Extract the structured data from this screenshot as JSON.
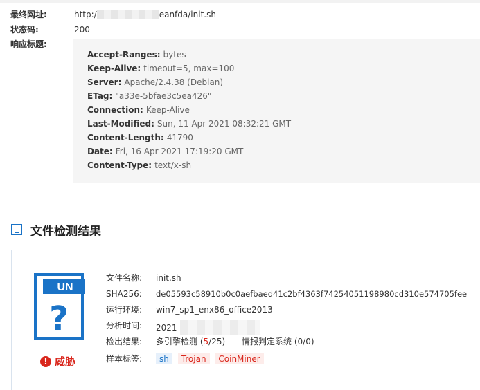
{
  "response": {
    "final_url_label": "最终网址:",
    "final_url_prefix": "http:/",
    "final_url_suffix": "eanfda/init.sh",
    "status_label": "状态码:",
    "status_value": "200",
    "headers_label": "响应标题:",
    "headers": [
      {
        "key": "Accept-Ranges:",
        "value": "bytes"
      },
      {
        "key": "Keep-Alive:",
        "value": "timeout=5, max=100"
      },
      {
        "key": "Server:",
        "value": "Apache/2.4.38 (Debian)"
      },
      {
        "key": "ETag:",
        "value": "\"a33e-5bfae3c5ea426\""
      },
      {
        "key": "Connection:",
        "value": "Keep-Alive"
      },
      {
        "key": "Last-Modified:",
        "value": "Sun, 11 Apr 2021 08:32:21 GMT"
      },
      {
        "key": "Content-Length:",
        "value": "41790"
      },
      {
        "key": "Date:",
        "value": "Fri, 16 Apr 2021 17:19:20 GMT"
      },
      {
        "key": "Content-Type:",
        "value": "text/x-sh"
      }
    ]
  },
  "section": {
    "title": "文件检测结果",
    "icon": "document-section-icon"
  },
  "file_result": {
    "icon_badge": "UN",
    "icon_glyph": "?",
    "verdict_icon": "!",
    "verdict": "威胁",
    "filename_label": "文件名称:",
    "filename": "init.sh",
    "sha256_label": "SHA256:",
    "sha256": "de05593c58910b0c0aefbaed41c2bf4363f74254051198980cd310e574705fee",
    "env_label": "运行环境:",
    "env": "win7_sp1_enx86_office2013",
    "time_label": "分析时间:",
    "time_prefix": "2021",
    "result_label": "检出结果:",
    "engine_label": "多引擎检测",
    "engine_open": "(",
    "engine_hits": "5",
    "engine_total": "/25)",
    "intel_label": "情报判定系统",
    "intel_value": "(0/0)",
    "tags_label": "样本标签:",
    "tags": [
      {
        "text": "sh",
        "color": "#1a73c7"
      },
      {
        "text": "Trojan",
        "color": "#d9261c"
      },
      {
        "text": "CoinMiner",
        "color": "#d9261c"
      }
    ]
  },
  "colors": {
    "accent": "#1a73c7",
    "threat": "#d9261c",
    "panel_bg": "#f5f5f5"
  }
}
